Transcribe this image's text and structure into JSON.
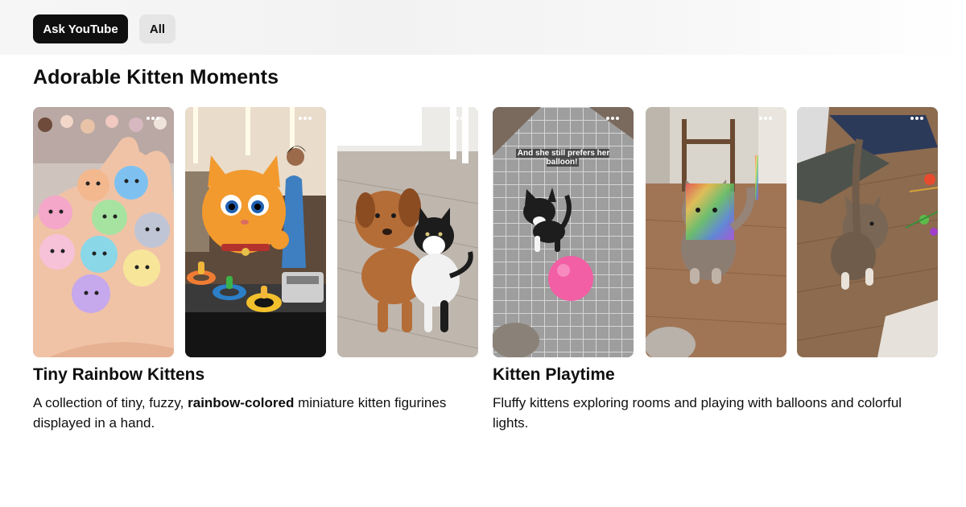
{
  "filters": {
    "ask_label": "Ask YouTube",
    "all_label": "All"
  },
  "section": {
    "title": "Adorable Kitten Moments"
  },
  "groups": [
    {
      "title": "Tiny Rainbow Kittens",
      "desc_before": "A collection of tiny, fuzzy, ",
      "desc_bold": "rainbow-colored",
      "desc_after": " miniature kitten figurines displayed in a hand."
    },
    {
      "title": "Kitten Playtime",
      "desc_before": "Fluffy kittens exploring rooms and playing with balloons and colorful lights.",
      "desc_bold": "",
      "desc_after": ""
    }
  ],
  "shorts": [
    {
      "subject": "Rainbow kitten figurines in hand",
      "overlay": ""
    },
    {
      "subject": "Cartoon orange cat at store checkout",
      "overlay": ""
    },
    {
      "subject": "Puppy and kitten hugging",
      "overlay": ""
    },
    {
      "subject": "Kitten with pink ball",
      "overlay": "And she still prefers her balloon!"
    },
    {
      "subject": "Fluffy kitten in rainbow light",
      "overlay": ""
    },
    {
      "subject": "Kitten playing on wooden floor",
      "overlay": ""
    }
  ],
  "icons": {
    "more": "more-options-icon"
  },
  "colors": {
    "ask_chip_bg": "#0f0f0f",
    "all_chip_bg": "#e5e5e5"
  }
}
